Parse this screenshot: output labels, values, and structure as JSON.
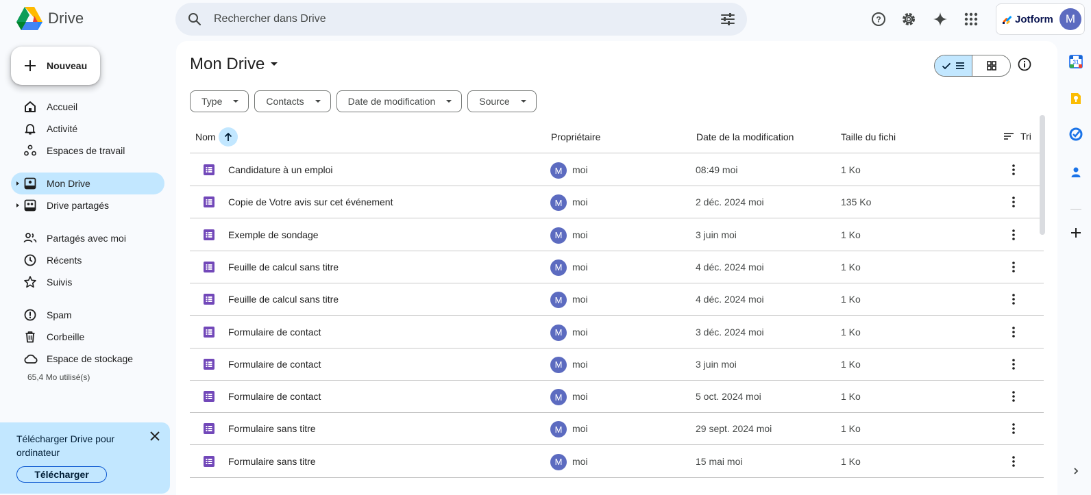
{
  "app": {
    "name": "Drive",
    "search_placeholder": "Rechercher dans Drive"
  },
  "account": {
    "brand_label": "Jotform",
    "avatar_initial": "M"
  },
  "sidebar": {
    "new_button": "Nouveau",
    "items": [
      {
        "label": "Accueil",
        "icon": "home-icon"
      },
      {
        "label": "Activité",
        "icon": "bell-icon"
      },
      {
        "label": "Espaces de travail",
        "icon": "workspaces-icon"
      },
      {
        "label": "Mon Drive",
        "icon": "my-drive-icon",
        "active": true
      },
      {
        "label": "Drive partagés",
        "icon": "shared-drives-icon"
      },
      {
        "label": "Partagés avec moi",
        "icon": "people-icon"
      },
      {
        "label": "Récents",
        "icon": "clock-icon"
      },
      {
        "label": "Suivis",
        "icon": "star-icon"
      },
      {
        "label": "Spam",
        "icon": "spam-icon"
      },
      {
        "label": "Corbeille",
        "icon": "trash-icon"
      },
      {
        "label": "Espace de stockage",
        "icon": "cloud-icon"
      }
    ],
    "storage_used": "65,4 Mo utilisé(s)",
    "promo": {
      "text": "Télécharger Drive pour ordinateur",
      "button": "Télécharger"
    }
  },
  "main": {
    "title": "Mon Drive",
    "filters": [
      "Type",
      "Contacts",
      "Date de modification",
      "Source"
    ],
    "columns": {
      "name": "Nom",
      "owner": "Propriétaire",
      "modified": "Date de la modification",
      "size": "Taille du fichier",
      "sort": "Tri"
    },
    "rows": [
      {
        "name": "Candidature à un emploi",
        "owner": "moi",
        "owner_initial": "M",
        "modified": "08:49 moi",
        "size": "1 Ko"
      },
      {
        "name": "Copie de Votre avis sur cet événement",
        "owner": "moi",
        "owner_initial": "M",
        "modified": "2 déc. 2024 moi",
        "size": "135 Ko"
      },
      {
        "name": "Exemple de sondage",
        "owner": "moi",
        "owner_initial": "M",
        "modified": "3 juin moi",
        "size": "1 Ko"
      },
      {
        "name": "Feuille de calcul sans titre",
        "owner": "moi",
        "owner_initial": "M",
        "modified": "4 déc. 2024 moi",
        "size": "1 Ko"
      },
      {
        "name": "Feuille de calcul sans titre",
        "owner": "moi",
        "owner_initial": "M",
        "modified": "4 déc. 2024 moi",
        "size": "1 Ko"
      },
      {
        "name": "Formulaire de contact",
        "owner": "moi",
        "owner_initial": "M",
        "modified": "3 déc. 2024 moi",
        "size": "1 Ko"
      },
      {
        "name": "Formulaire de contact",
        "owner": "moi",
        "owner_initial": "M",
        "modified": "3 juin moi",
        "size": "1 Ko"
      },
      {
        "name": "Formulaire de contact",
        "owner": "moi",
        "owner_initial": "M",
        "modified": "5 oct. 2024 moi",
        "size": "1 Ko"
      },
      {
        "name": "Formulaire sans titre",
        "owner": "moi",
        "owner_initial": "M",
        "modified": "29 sept. 2024 moi",
        "size": "1 Ko"
      },
      {
        "name": "Formulaire sans titre",
        "owner": "moi",
        "owner_initial": "M",
        "modified": "15 mai moi",
        "size": "1 Ko"
      }
    ]
  },
  "colors": {
    "accent": "#0b57d0",
    "active_bg": "#c2e7ff",
    "forms_purple": "#7248b9",
    "avatar": "#5c6bc0"
  },
  "side_panel": [
    "calendar-icon",
    "keep-icon",
    "tasks-icon",
    "contacts-icon",
    "plus-icon"
  ]
}
